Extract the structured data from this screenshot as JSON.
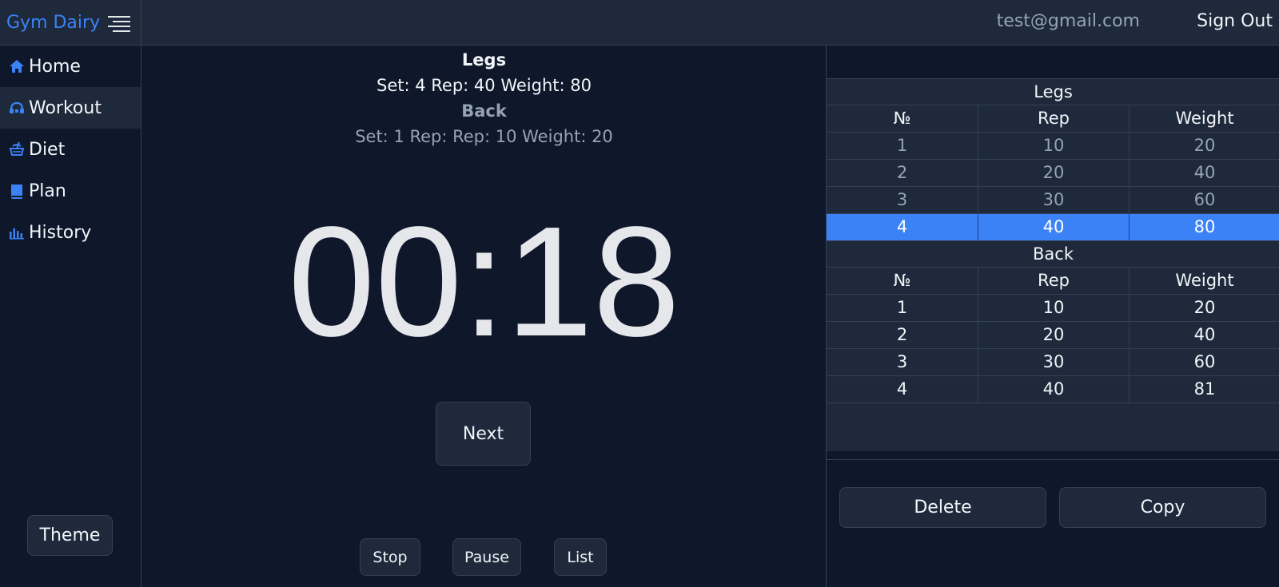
{
  "header": {
    "brand": "Gym Dairy",
    "email": "test@gmail.com",
    "sign_out": "Sign Out",
    "accent": "#3b82f6"
  },
  "sidebar": {
    "items": [
      {
        "label": "Home",
        "icon": "home-icon"
      },
      {
        "label": "Workout",
        "icon": "dumbbell-icon",
        "active": true
      },
      {
        "label": "Diet",
        "icon": "diet-icon"
      },
      {
        "label": "Plan",
        "icon": "book-icon"
      },
      {
        "label": "History",
        "icon": "chart-icon"
      }
    ],
    "theme_label": "Theme"
  },
  "main": {
    "current_exercise": "Legs",
    "current_info": "Set: 4 Rep: 40 Weight: 80",
    "next_exercise": "Back",
    "next_info": "Set: 1 Rep: Rep: 10 Weight: 20",
    "timer": "00:18",
    "next_label": "Next",
    "stop_label": "Stop",
    "pause_label": "Pause",
    "list_label": "List"
  },
  "panel": {
    "tables": [
      {
        "title": "Legs",
        "headers": [
          "№",
          "Rep",
          "Weight"
        ],
        "rows": [
          [
            "1",
            "10",
            "20"
          ],
          [
            "2",
            "20",
            "40"
          ],
          [
            "3",
            "30",
            "60"
          ],
          [
            "4",
            "40",
            "80"
          ]
        ],
        "selected_row": 3
      },
      {
        "title": "Back",
        "headers": [
          "№",
          "Rep",
          "Weight"
        ],
        "rows": [
          [
            "1",
            "10",
            "20"
          ],
          [
            "2",
            "20",
            "40"
          ],
          [
            "3",
            "30",
            "60"
          ],
          [
            "4",
            "40",
            "81"
          ]
        ]
      }
    ],
    "delete_label": "Delete",
    "copy_label": "Copy"
  }
}
